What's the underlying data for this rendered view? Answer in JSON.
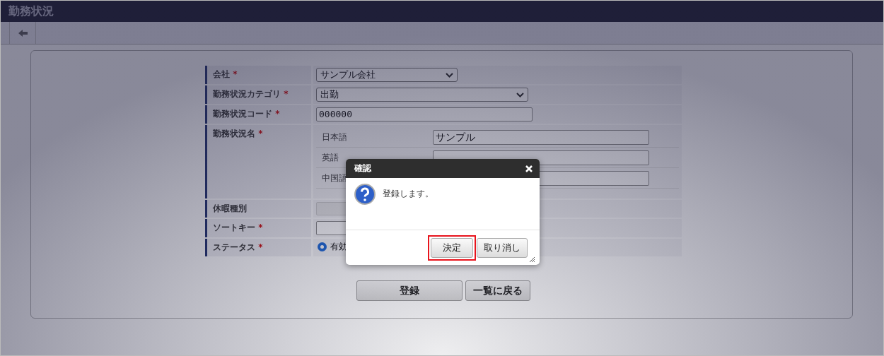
{
  "window": {
    "title": "勤務状況"
  },
  "form": [
    {
      "kind": "select",
      "label": "会社",
      "required_mark": "*",
      "value": "サンプル会社"
    },
    {
      "kind": "select",
      "label": "勤務状況カテゴリ",
      "required_mark": "*",
      "value": "出勤"
    },
    {
      "kind": "text",
      "label": "勤務状況コード",
      "required_mark": "*",
      "value": "000000"
    },
    {
      "kind": "multilang",
      "label": "勤務状況名",
      "required_mark": "*",
      "langs": [
        {
          "label": "日本語",
          "value": "サンプル"
        },
        {
          "label": "英語"
        },
        {
          "label": "中国語"
        }
      ]
    },
    {
      "kind": "disabled",
      "label": "休暇種別"
    },
    {
      "kind": "text",
      "label": "ソートキー",
      "required_mark": "*"
    },
    {
      "kind": "radio",
      "label": "ステータス",
      "required_mark": "*",
      "options": [
        {
          "label": "有効",
          "selected": true
        }
      ]
    }
  ],
  "buttons": [
    "登録",
    "一覧に戻る"
  ],
  "dialog": {
    "title": "確認",
    "message": "登録します。",
    "buttons": [
      {
        "label": "決定",
        "highlighted": true
      },
      {
        "label": "取り消し",
        "highlighted": false
      }
    ]
  }
}
